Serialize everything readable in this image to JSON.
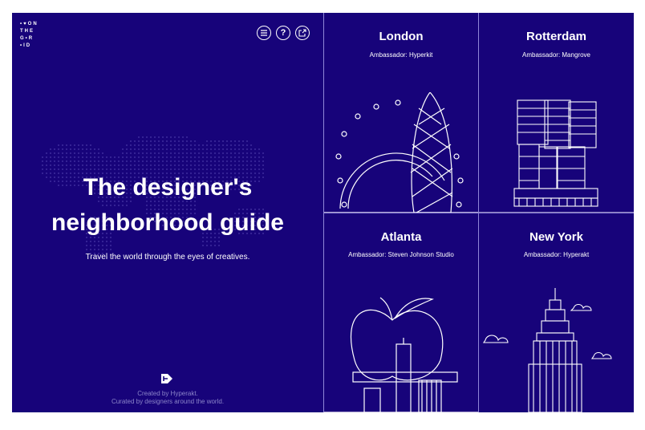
{
  "logo": {
    "line1": "•♥ON",
    "line2": "THE",
    "line3": "G•R",
    "line4": "•ID"
  },
  "header_icons": [
    "menu-icon",
    "help-icon",
    "share-icon"
  ],
  "hero": {
    "title_line1": "The designer's",
    "title_line2": "neighborhood guide",
    "subtitle": "Travel the world through the eyes of creatives."
  },
  "footer": {
    "created": "Created by Hyperakt.",
    "curated": "Curated by designers around the world."
  },
  "cities": [
    {
      "name": "London",
      "ambassador": "Ambassador: Hyperkit"
    },
    {
      "name": "Rotterdam",
      "ambassador": "Ambassador: Mangrove"
    },
    {
      "name": "Atlanta",
      "ambassador": "Ambassador: Steven Johnson Studio"
    },
    {
      "name": "New York",
      "ambassador": "Ambassador: Hyperakt"
    }
  ],
  "colors": {
    "background": "#17037a",
    "line": "#ffffff",
    "divider": "#8f86d8",
    "muted": "#8b85c9"
  }
}
